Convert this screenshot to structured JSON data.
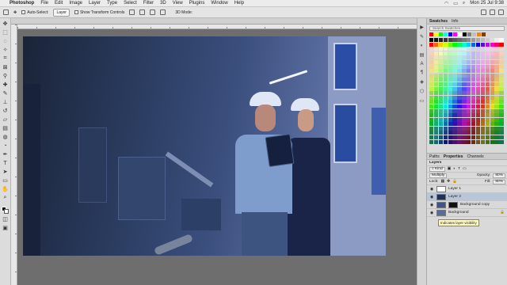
{
  "menubar": {
    "app_name": "Photoshop",
    "items": [
      "File",
      "Edit",
      "Image",
      "Layer",
      "Type",
      "Select",
      "Filter",
      "3D",
      "View",
      "Plugins",
      "Window",
      "Help"
    ],
    "clock": "Mon 25 Jul 9:38"
  },
  "options": {
    "auto_select_label": "Auto-Select:",
    "auto_select_value": "Layer",
    "transform_label": "Show Transform Controls",
    "mode_label": "3D Mode:"
  },
  "document": {
    "tab_title": ""
  },
  "swatches_panel": {
    "tabs": [
      "Swatches",
      "Info"
    ],
    "search_placeholder": "Search Swatches",
    "recent_colors": [
      "#ff0000",
      "#ffff00",
      "#00ff00",
      "#00ffff",
      "#0000ff",
      "#ff00ff",
      "#ffffff",
      "#000000",
      "#808080",
      "#c0c0c0",
      "#ff8000",
      "#804000"
    ]
  },
  "layers_panel": {
    "tabs": [
      "Paths",
      "Properties",
      "Channels"
    ],
    "title": "Layers",
    "kind_label": "Kind",
    "blend_mode": "Multiply",
    "opacity_label": "Opacity:",
    "opacity_value": "80%",
    "lock_label": "Lock:",
    "fill_label": "Fill:",
    "fill_value": "80%",
    "layers": [
      {
        "name": "Layer 1",
        "selected": false
      },
      {
        "name": "Layer 2",
        "selected": true
      },
      {
        "name": "Background copy",
        "selected": false
      },
      {
        "name": "Background",
        "selected": false
      }
    ],
    "tooltip": "Indicates layer visibility"
  }
}
